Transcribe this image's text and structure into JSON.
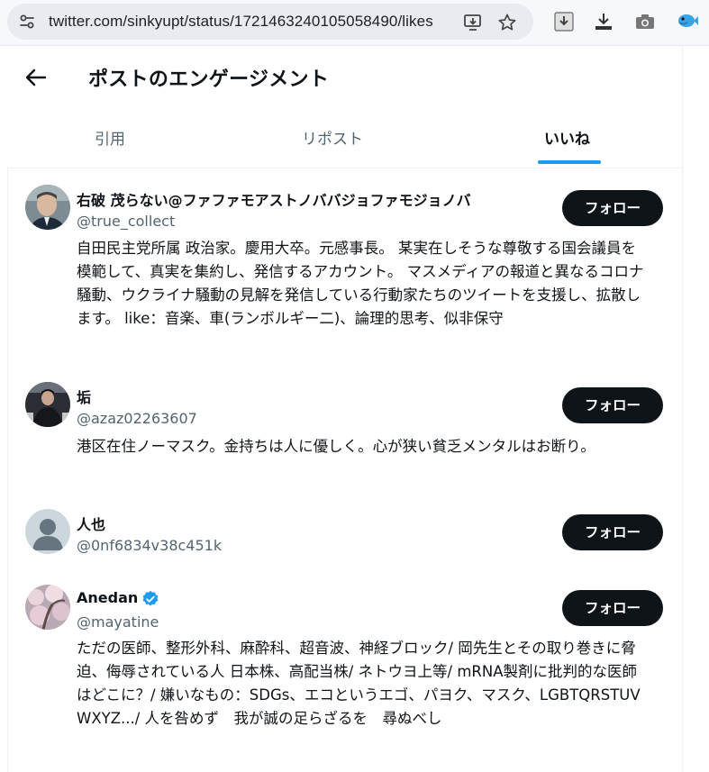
{
  "browser": {
    "url": "twitter.com/sinkyupt/status/1721463240105058490/likes"
  },
  "header": {
    "title": "ポストのエンゲージメント",
    "tabs": [
      {
        "label": "引用"
      },
      {
        "label": "リポスト"
      },
      {
        "label": "いいね",
        "active": true
      }
    ]
  },
  "users": [
    {
      "name": "右破 茂らない@ファファモアストノババジョファモジョノバ",
      "handle": "@true_collect",
      "bio": "自田民主党所属 政治家。慶用大卒。元感事長。 某実在しそうな尊敬する国会議員を模範して、真実を集約し、発信するアカウント。 マスメディアの報道と異なるコロナ騒動、ウクライナ騒動の見解を発信している行動家たちのツイートを支援し、拡散します。 like：音楽、車(ランボルギー二)、論理的思考、似非保守",
      "follow_label": "フォロー",
      "verified": false
    },
    {
      "name": "垢",
      "handle": "@azaz02263607",
      "bio": "港区在住ノーマスク。金持ちは人に優しく。心が狭い貧乏メンタルはお断り。",
      "follow_label": "フォロー",
      "verified": false
    },
    {
      "name": "人也",
      "handle": "@0nf6834v38c451k",
      "bio": "",
      "follow_label": "フォロー",
      "verified": false
    },
    {
      "name": "Anedan",
      "handle": "@mayatine",
      "bio": "ただの医師、整形外科、麻酔科、超音波、神経ブロック/ 岡先生とその取り巻きに脅迫、侮辱されている人 日本株、高配当株/ ネトウヨ上等/ mRNA製剤に批判的な医師はどこに？/ 嫌いなもの：SDGs、エコというエゴ、パヨク、マスク、LGBTQRSTUVWXYZ.../ 人を咎めず　我が誠の足らざるを　尋ぬべし",
      "follow_label": "フォロー",
      "verified": true
    }
  ],
  "colors": {
    "accent": "#1d9bf0",
    "text": "#0f1419",
    "secondary": "#536471",
    "button_bg": "#0f1419"
  }
}
